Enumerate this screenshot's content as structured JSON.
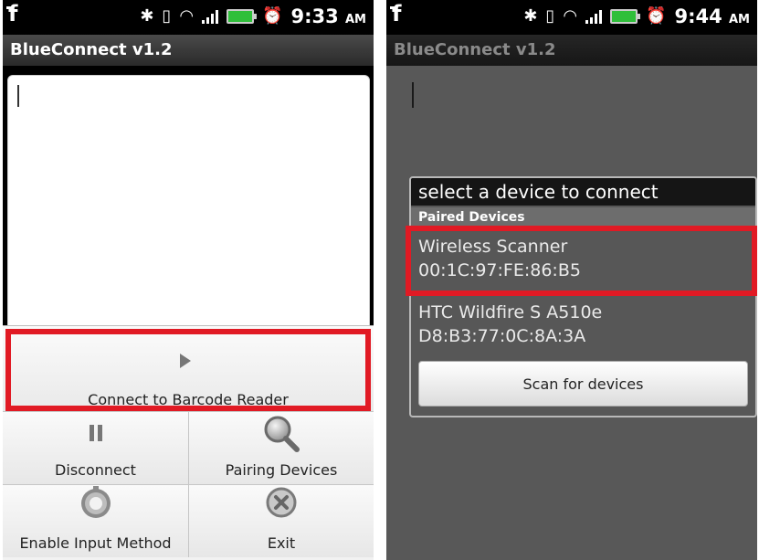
{
  "left": {
    "status": {
      "time": "9:33",
      "ampm": "AM"
    },
    "app_title": "BlueConnect v1.2",
    "menu": {
      "connect_label": "Connect to Barcode Reader",
      "disconnect_label": "Disconnect",
      "pairing_label": "Pairing Devices",
      "enable_input_label": "Enable Input Method",
      "exit_label": "Exit"
    }
  },
  "right": {
    "status": {
      "time": "9:44",
      "ampm": "AM"
    },
    "app_title": "BlueConnect v1.2",
    "dialog": {
      "title": "select a device to connect",
      "section": "Paired Devices",
      "devices": [
        {
          "name": "Wireless Scanner",
          "address": "00:1C:97:FE:86:B5"
        },
        {
          "name": "HTC Wildfire S A510e",
          "address": "D8:B3:77:0C:8A:3A"
        }
      ],
      "scan_label": "Scan for devices"
    }
  },
  "colors": {
    "highlight": "#e11a24",
    "battery": "#2fbf3a"
  },
  "icons": [
    "facebook-icon",
    "bluetooth-icon",
    "vibrate-icon",
    "wifi-icon",
    "signal-icon",
    "battery-icon",
    "alarm-icon",
    "play-icon",
    "pause-icon",
    "magnifier-icon",
    "gear-icon",
    "exit-icon"
  ]
}
